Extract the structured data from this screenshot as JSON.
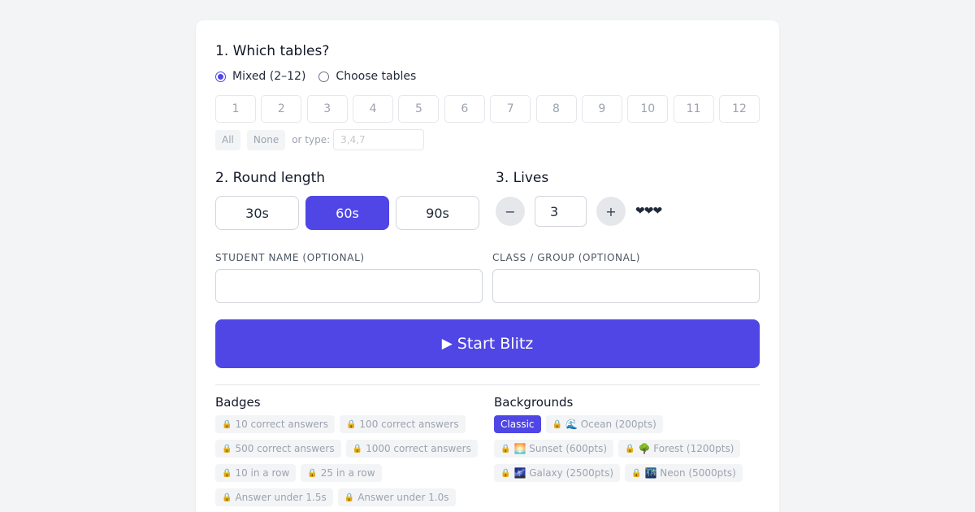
{
  "section1": {
    "title": "1. Which tables?",
    "options": [
      {
        "label": "Mixed (2–12)",
        "checked": true
      },
      {
        "label": "Choose tables",
        "checked": false
      }
    ],
    "tables": [
      "1",
      "2",
      "3",
      "4",
      "5",
      "6",
      "7",
      "8",
      "9",
      "10",
      "11",
      "12"
    ],
    "all_label": "All",
    "none_label": "None",
    "type_label": "or type:",
    "type_placeholder": "3,4,7"
  },
  "section2": {
    "title": "2. Round length",
    "options": [
      "30s",
      "60s",
      "90s"
    ],
    "selected": "60s"
  },
  "section3": {
    "title": "3. Lives",
    "minus": "−",
    "plus": "+",
    "value": "3",
    "hearts": "❤❤❤"
  },
  "fields": {
    "student_label": "Student name (optional)",
    "class_label": "Class / group (optional)"
  },
  "start": {
    "icon": "▶",
    "label": "Start Blitz"
  },
  "badges": {
    "title": "Badges",
    "lock_icon": "🔒",
    "items": [
      "10 correct answers",
      "100 correct answers",
      "500 correct answers",
      "1000 correct answers",
      "10 in a row",
      "25 in a row",
      "Answer under 1.5s",
      "Answer under 1.0s"
    ]
  },
  "backgrounds": {
    "title": "Backgrounds",
    "lock_icon": "🔒",
    "items": [
      {
        "label": "Classic",
        "locked": false,
        "active": true
      },
      {
        "label": "🌊 Ocean (200pts)",
        "locked": true,
        "active": false
      },
      {
        "label": "🌅 Sunset (600pts)",
        "locked": true,
        "active": false
      },
      {
        "label": "🌳 Forest (1200pts)",
        "locked": true,
        "active": false
      },
      {
        "label": "🌌 Galaxy (2500pts)",
        "locked": true,
        "active": false
      },
      {
        "label": "🌃 Neon (5000pts)",
        "locked": true,
        "active": false
      }
    ]
  },
  "colors": {
    "accent": "#4f46e5",
    "background": "#f3f4f6"
  }
}
